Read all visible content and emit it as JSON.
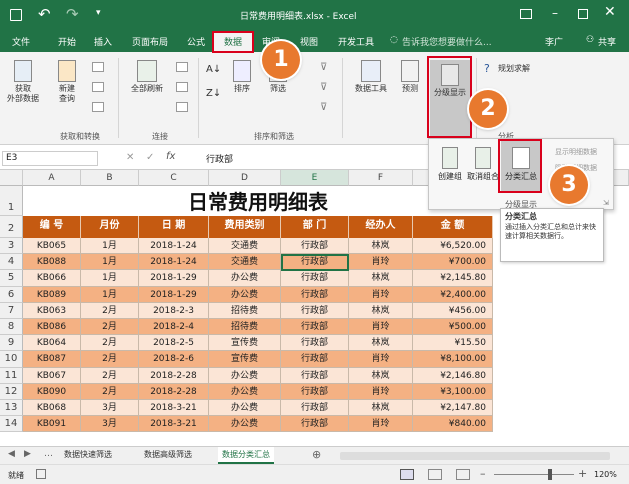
{
  "titlebar": {
    "title": "日常费用明细表.xlsx - Excel"
  },
  "tabs": [
    "文件",
    "开始",
    "插入",
    "页面布局",
    "公式",
    "数据",
    "审阅",
    "视图",
    "开发工具"
  ],
  "tell_me": "告诉我您想要做什么...",
  "user": "李广",
  "share": "共享",
  "ribbon": {
    "get_external": "获取\n外部数据",
    "new_query": "新建\n查询",
    "refresh_all": "全部刷新",
    "sort": "排序",
    "filter": "筛选",
    "data_tools": "数据工具",
    "forecast": "预测",
    "outline": "分级显示",
    "solver": "规划求解",
    "analysis": "分析",
    "grp_get_transform": "获取和转换",
    "grp_connections": "连接",
    "grp_sort_filter": "排序和筛选"
  },
  "popup": {
    "group": "创建组",
    "ungroup": "取消组合",
    "subtotal": "分类汇总",
    "show_detail": "显示明细数据",
    "hide_detail": "隐藏明细数据",
    "label": "分级显示"
  },
  "tooltip": {
    "title": "分类汇总",
    "body": "通过插入分类汇总和总计来快速计算相关数据行。"
  },
  "formula": {
    "namebox": "E3",
    "value": "行政部"
  },
  "columns": [
    "A",
    "B",
    "C",
    "D",
    "E",
    "F",
    "G"
  ],
  "sheet_title": "日常费用明细表",
  "headers": [
    "编 号",
    "月份",
    "日 期",
    "费用类别",
    "部 门",
    "经办人",
    "金 额"
  ],
  "rows": [
    {
      "n": "3",
      "c": [
        "KB065",
        "1月",
        "2018-1-24",
        "交通费",
        "行政部",
        "林岚",
        "¥6,520.00"
      ]
    },
    {
      "n": "4",
      "c": [
        "KB088",
        "1月",
        "2018-1-24",
        "交通费",
        "行政部",
        "肖玲",
        "¥700.00"
      ]
    },
    {
      "n": "5",
      "c": [
        "KB066",
        "1月",
        "2018-1-29",
        "办公费",
        "行政部",
        "林岚",
        "¥2,145.80"
      ]
    },
    {
      "n": "6",
      "c": [
        "KB089",
        "1月",
        "2018-1-29",
        "办公费",
        "行政部",
        "肖玲",
        "¥2,400.00"
      ]
    },
    {
      "n": "7",
      "c": [
        "KB063",
        "2月",
        "2018-2-3",
        "招待费",
        "行政部",
        "林岚",
        "¥456.00"
      ]
    },
    {
      "n": "8",
      "c": [
        "KB086",
        "2月",
        "2018-2-4",
        "招待费",
        "行政部",
        "肖玲",
        "¥500.00"
      ]
    },
    {
      "n": "9",
      "c": [
        "KB064",
        "2月",
        "2018-2-5",
        "宣传费",
        "行政部",
        "林岚",
        "¥15.50"
      ]
    },
    {
      "n": "10",
      "c": [
        "KB087",
        "2月",
        "2018-2-6",
        "宣传费",
        "行政部",
        "肖玲",
        "¥8,100.00"
      ]
    },
    {
      "n": "11",
      "c": [
        "KB067",
        "2月",
        "2018-2-28",
        "办公费",
        "行政部",
        "林岚",
        "¥2,146.80"
      ]
    },
    {
      "n": "12",
      "c": [
        "KB090",
        "2月",
        "2018-2-28",
        "办公费",
        "行政部",
        "肖玲",
        "¥3,100.00"
      ]
    },
    {
      "n": "13",
      "c": [
        "KB068",
        "3月",
        "2018-3-21",
        "办公费",
        "行政部",
        "林岚",
        "¥2,147.80"
      ]
    },
    {
      "n": "14",
      "c": [
        "KB091",
        "3月",
        "2018-3-21",
        "办公费",
        "行政部",
        "肖玲",
        "¥840.00"
      ]
    }
  ],
  "sheet_tabs": [
    "数据快速筛选",
    "数据高级筛选",
    "数据分类汇总"
  ],
  "status": {
    "ready": "就绪",
    "zoom": "120%"
  },
  "badges": [
    "1",
    "2",
    "3"
  ],
  "colors": {
    "excel_green": "#217346",
    "header_fill": "#c55a11",
    "row_fill": "#f4b183",
    "row_fill_alt": "#fbe5d6",
    "badge": "#e8792e",
    "highlight": "#d9001b"
  }
}
